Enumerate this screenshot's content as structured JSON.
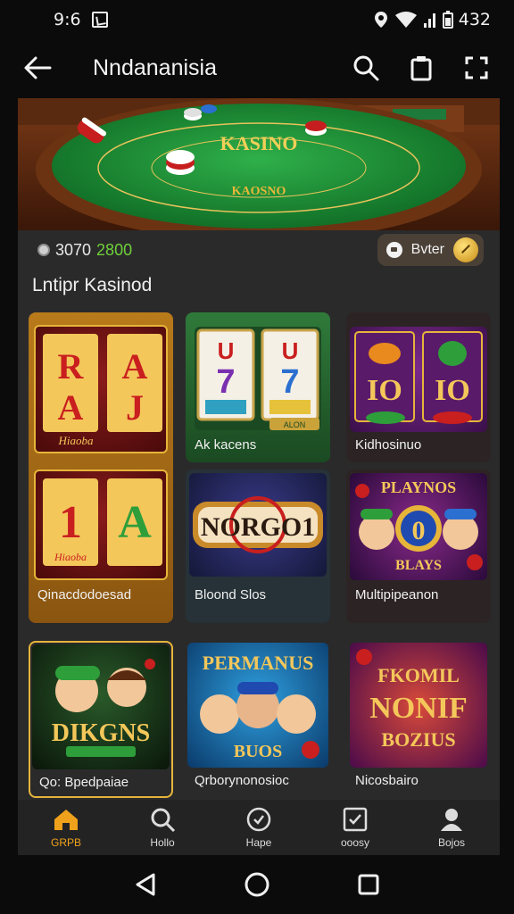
{
  "status_bar": {
    "time": "9:6",
    "battery_time": "432"
  },
  "app_bar": {
    "title": "Nndananisia"
  },
  "hero": {
    "table_title": "KASINO",
    "table_subtitle": "KAOSNO"
  },
  "balance": {
    "amount_main": "3070",
    "amount_bonus": "2800"
  },
  "enter_button": {
    "label": "Bvter"
  },
  "section": {
    "title": "Lntipr Kasinod"
  },
  "games": [
    {
      "label": "",
      "art": "RAJ",
      "art_sub": "Hiaoba"
    },
    {
      "label": "Ak kacens",
      "art": "77",
      "art_sub": "ALON"
    },
    {
      "label": "Kidhosinuo",
      "art": "IO",
      "art_sub": ""
    },
    {
      "label": "Qinacdodoesad",
      "art": "1A",
      "art_sub": "Hiaoba"
    },
    {
      "label": "Bloond Slos",
      "art": "NORGO1",
      "art_sub": ""
    },
    {
      "label": "Multipipeanon",
      "art": "PLAYNOS",
      "art_sub": "BLAYS"
    },
    {
      "label": "Qo: Bpedpaiae",
      "art": "DIKGNS",
      "art_sub": ""
    },
    {
      "label": "Qrborynonosioc",
      "art": "PERMANUS",
      "art_sub": "BUOS"
    },
    {
      "label": "Nicosbairo",
      "art": "NONIF",
      "art_sub": "BOZIUS"
    }
  ],
  "bottom_nav": [
    {
      "label": "GRPB",
      "icon": "home-icon",
      "active": true
    },
    {
      "label": "Hollo",
      "icon": "search-icon",
      "active": false
    },
    {
      "label": "Hape",
      "icon": "coin-icon",
      "active": false
    },
    {
      "label": "ooosy",
      "icon": "check-box-icon",
      "active": false
    },
    {
      "label": "Bojos",
      "icon": "profile-icon",
      "active": false
    }
  ],
  "colors": {
    "accent": "#f0a11b",
    "bonus_green": "#6fd13a",
    "background": "#0b0b0c",
    "surface": "#2a2a2b"
  }
}
